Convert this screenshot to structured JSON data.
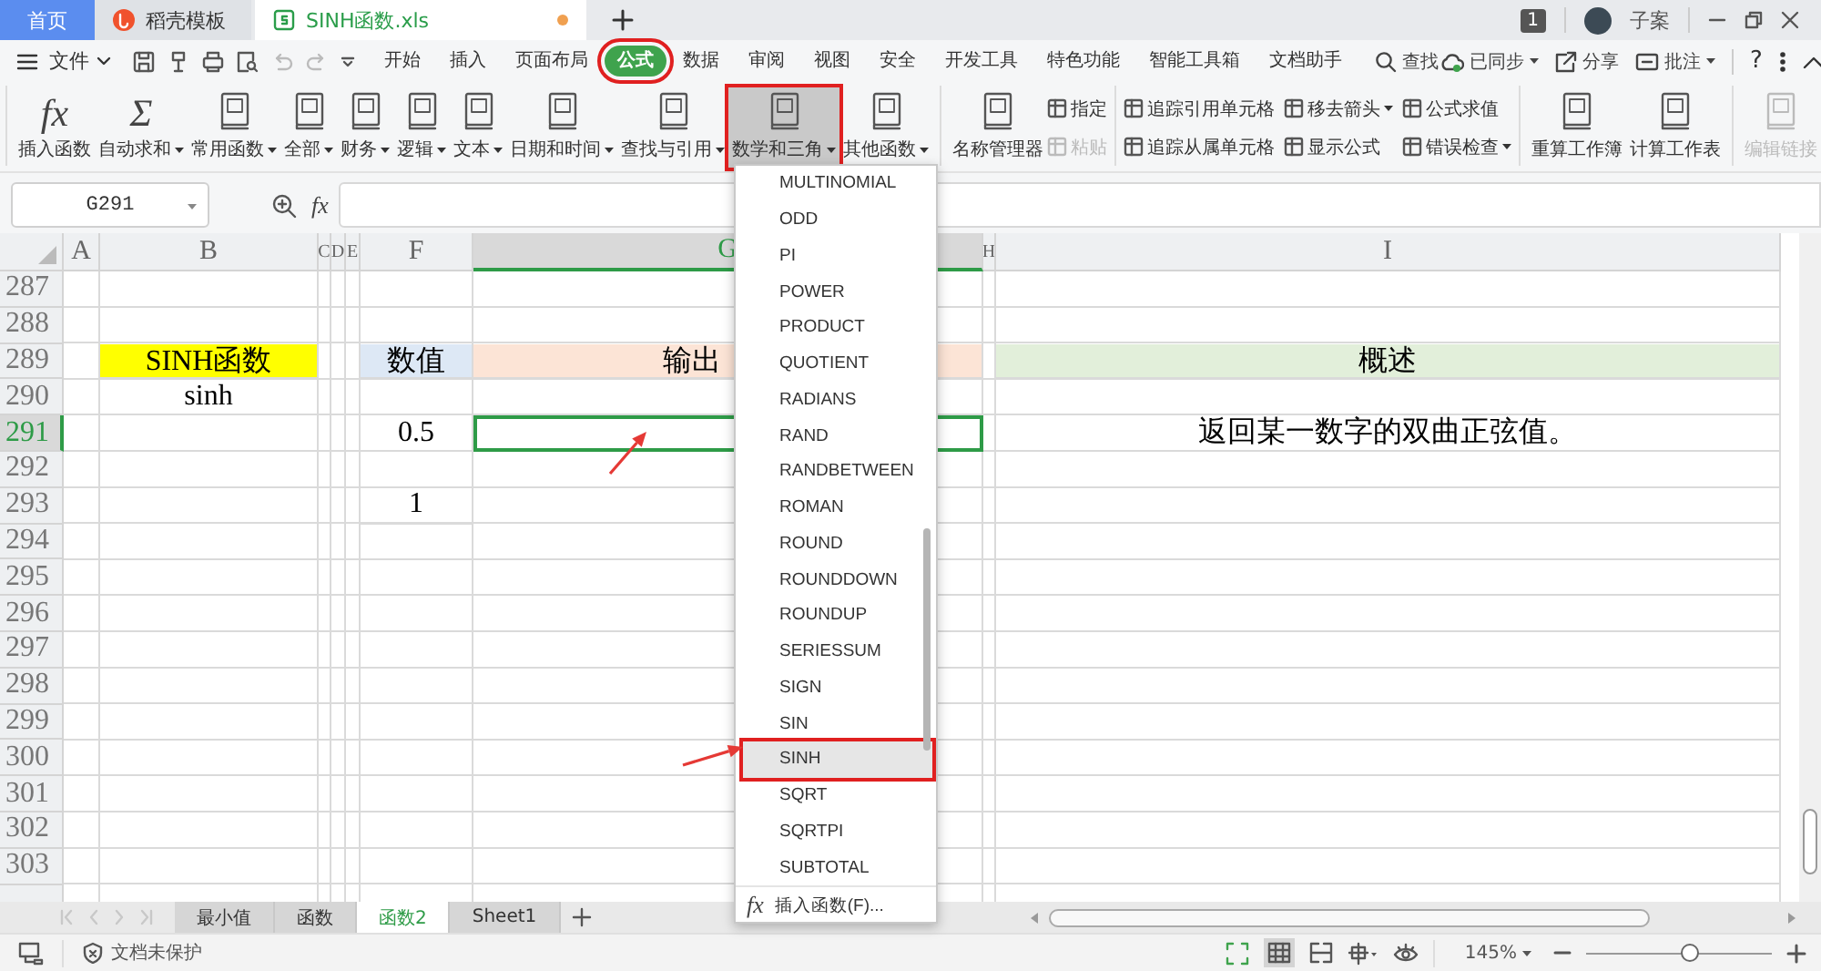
{
  "title_bar": {
    "tabs": [
      {
        "kind": "home",
        "label": "首页",
        "selected": false,
        "unsaved": false
      },
      {
        "kind": "app",
        "label": "稻壳模板",
        "selected": false,
        "unsaved": false
      },
      {
        "kind": "document",
        "label": "SINH函数.xls",
        "selected": true,
        "unsaved": true
      }
    ],
    "window_count": "1",
    "user": "子案"
  },
  "menu_bar": {
    "file": "文件",
    "tabs": [
      {
        "label": "开始",
        "selected": false,
        "highlighted": false
      },
      {
        "label": "插入",
        "selected": false,
        "highlighted": false
      },
      {
        "label": "页面布局",
        "selected": false,
        "highlighted": false
      },
      {
        "label": "公式",
        "selected": true,
        "highlighted": true
      },
      {
        "label": "数据",
        "selected": false,
        "highlighted": false
      },
      {
        "label": "审阅",
        "selected": false,
        "highlighted": false
      },
      {
        "label": "视图",
        "selected": false,
        "highlighted": false
      },
      {
        "label": "安全",
        "selected": false,
        "highlighted": false
      },
      {
        "label": "开发工具",
        "selected": false,
        "highlighted": false
      },
      {
        "label": "特色功能",
        "selected": false,
        "highlighted": false
      },
      {
        "label": "智能工具箱",
        "selected": false,
        "highlighted": false
      },
      {
        "label": "文档助手",
        "selected": false,
        "highlighted": false
      }
    ],
    "search": "查找",
    "sync": "已同步",
    "share": "分享",
    "comment": "批注",
    "help": "?"
  },
  "ribbon": {
    "sections": [
      {
        "items": [
          {
            "kind": "large",
            "label": "插入函数",
            "symbol": "fx",
            "dropdown": false,
            "disabled": false,
            "open": false,
            "highlighted": false
          },
          {
            "kind": "large",
            "label": "自动求和",
            "symbol": "Σ",
            "dropdown": true,
            "disabled": false,
            "open": false,
            "highlighted": false
          },
          {
            "kind": "large",
            "label": "常用函数",
            "dropdown": true,
            "disabled": false,
            "open": false,
            "highlighted": false
          },
          {
            "kind": "large",
            "label": "全部",
            "dropdown": true,
            "disabled": false,
            "open": false,
            "highlighted": false
          },
          {
            "kind": "large",
            "label": "财务",
            "dropdown": true,
            "disabled": false,
            "open": false,
            "highlighted": false
          },
          {
            "kind": "large",
            "label": "逻辑",
            "dropdown": true,
            "disabled": false,
            "open": false,
            "highlighted": false
          },
          {
            "kind": "large",
            "label": "文本",
            "dropdown": true,
            "disabled": false,
            "open": false,
            "highlighted": false
          },
          {
            "kind": "large",
            "label": "日期和时间",
            "dropdown": true,
            "disabled": false,
            "open": false,
            "highlighted": false
          },
          {
            "kind": "large",
            "label": "查找与引用",
            "dropdown": true,
            "disabled": false,
            "open": false,
            "highlighted": false
          },
          {
            "kind": "large",
            "label": "数学和三角",
            "dropdown": true,
            "disabled": false,
            "open": true,
            "highlighted": true
          },
          {
            "kind": "large",
            "label": "其他函数",
            "dropdown": true,
            "disabled": false,
            "open": false,
            "highlighted": false
          }
        ]
      },
      {
        "items": [
          {
            "kind": "large",
            "label": "名称管理器",
            "dropdown": false,
            "disabled": false,
            "open": false,
            "highlighted": false
          },
          {
            "kind": "small",
            "label": "指定",
            "dropdown": false,
            "disabled": false,
            "open": false,
            "highlighted": false
          },
          {
            "kind": "small",
            "label": "粘贴",
            "dropdown": false,
            "disabled": true,
            "open": false,
            "highlighted": false
          }
        ]
      },
      {
        "items": [
          {
            "kind": "small",
            "label": "追踪引用单元格",
            "dropdown": false,
            "disabled": false,
            "open": false,
            "highlighted": false
          },
          {
            "kind": "small",
            "label": "追踪从属单元格",
            "dropdown": false,
            "disabled": false,
            "open": false,
            "highlighted": false
          },
          {
            "kind": "small",
            "label": "移去箭头",
            "dropdown": true,
            "disabled": false,
            "open": false,
            "highlighted": false
          },
          {
            "kind": "small",
            "label": "显示公式",
            "dropdown": false,
            "disabled": false,
            "open": false,
            "highlighted": false
          },
          {
            "kind": "small",
            "label": "公式求值",
            "dropdown": false,
            "disabled": false,
            "open": false,
            "highlighted": false
          },
          {
            "kind": "small",
            "label": "错误检查",
            "dropdown": true,
            "disabled": false,
            "open": false,
            "highlighted": false
          }
        ]
      },
      {
        "items": [
          {
            "kind": "large",
            "label": "重算工作簿",
            "dropdown": false,
            "disabled": false,
            "open": false,
            "highlighted": false
          },
          {
            "kind": "large",
            "label": "计算工作表",
            "dropdown": false,
            "disabled": false,
            "open": false,
            "highlighted": false
          }
        ]
      },
      {
        "items": [
          {
            "kind": "large",
            "label": "编辑链接",
            "dropdown": false,
            "disabled": true,
            "open": false,
            "highlighted": false
          }
        ]
      }
    ]
  },
  "formula_bar": {
    "name_box": "G291",
    "fx": "fx"
  },
  "sheet": {
    "columns": [
      {
        "label": "A",
        "selected": false
      },
      {
        "label": "B",
        "selected": false
      },
      {
        "label": "C",
        "selected": false
      },
      {
        "label": "D",
        "selected": false
      },
      {
        "label": "E",
        "selected": false
      },
      {
        "label": "F",
        "selected": false
      },
      {
        "label": "G",
        "selected": true
      },
      {
        "label": "H",
        "selected": false
      },
      {
        "label": "I",
        "selected": false
      }
    ],
    "rows": [
      {
        "label": "287",
        "selected": false
      },
      {
        "label": "288",
        "selected": false
      },
      {
        "label": "289",
        "selected": false,
        "cells": {
          "B": {
            "text": "SINH函数",
            "color": "#ffff00"
          },
          "F": {
            "text": "数值",
            "color": "#dde8f5"
          },
          "G": {
            "text": "输出",
            "color": "#fce4d6"
          },
          "I": {
            "text": "概述",
            "color": "#e2efda"
          }
        }
      },
      {
        "label": "290",
        "selected": false,
        "cells": {
          "B": {
            "text": "sinh"
          }
        }
      },
      {
        "label": "291",
        "selected": true,
        "cells": {
          "F": {
            "text": "0.5"
          },
          "I": {
            "text": "返回某一数字的双曲正弦值。"
          }
        }
      },
      {
        "label": "292",
        "selected": false
      },
      {
        "label": "293",
        "selected": false,
        "cells": {
          "F": {
            "text": "1"
          }
        }
      },
      {
        "label": "294",
        "selected": false
      },
      {
        "label": "295",
        "selected": false
      },
      {
        "label": "296",
        "selected": false
      },
      {
        "label": "297",
        "selected": false
      },
      {
        "label": "298",
        "selected": false
      },
      {
        "label": "299",
        "selected": false
      },
      {
        "label": "300",
        "selected": false
      },
      {
        "label": "301",
        "selected": false
      },
      {
        "label": "302",
        "selected": false
      },
      {
        "label": "303",
        "selected": false
      }
    ]
  },
  "function_menu": {
    "items": [
      {
        "label": "MULTINOMIAL",
        "selected": false,
        "highlighted": false
      },
      {
        "label": "ODD",
        "selected": false,
        "highlighted": false
      },
      {
        "label": "PI",
        "selected": false,
        "highlighted": false
      },
      {
        "label": "POWER",
        "selected": false,
        "highlighted": false
      },
      {
        "label": "PRODUCT",
        "selected": false,
        "highlighted": false
      },
      {
        "label": "QUOTIENT",
        "selected": false,
        "highlighted": false
      },
      {
        "label": "RADIANS",
        "selected": false,
        "highlighted": false
      },
      {
        "label": "RAND",
        "selected": false,
        "highlighted": false
      },
      {
        "label": "RANDBETWEEN",
        "selected": false,
        "highlighted": false
      },
      {
        "label": "ROMAN",
        "selected": false,
        "highlighted": false
      },
      {
        "label": "ROUND",
        "selected": false,
        "highlighted": false
      },
      {
        "label": "ROUNDDOWN",
        "selected": false,
        "highlighted": false
      },
      {
        "label": "ROUNDUP",
        "selected": false,
        "highlighted": false
      },
      {
        "label": "SERIESSUM",
        "selected": false,
        "highlighted": false
      },
      {
        "label": "SIGN",
        "selected": false,
        "highlighted": false
      },
      {
        "label": "SIN",
        "selected": false,
        "highlighted": false
      },
      {
        "label": "SINH",
        "selected": true,
        "highlighted": true
      },
      {
        "label": "SQRT",
        "selected": false,
        "highlighted": false
      },
      {
        "label": "SQRTPI",
        "selected": false,
        "highlighted": false
      },
      {
        "label": "SUBTOTAL",
        "selected": false,
        "highlighted": false
      }
    ],
    "footer": {
      "symbol": "fx",
      "label": "插入函数(F)..."
    }
  },
  "sheet_tabs": [
    {
      "label": "最小值",
      "selected": false
    },
    {
      "label": "函数",
      "selected": false
    },
    {
      "label": "函数2",
      "selected": true
    },
    {
      "label": "Sheet1",
      "selected": false
    }
  ],
  "status_bar": {
    "protection": "文档未保护",
    "zoom": "145%",
    "zoom_slider": {
      "level": 0.56
    }
  }
}
